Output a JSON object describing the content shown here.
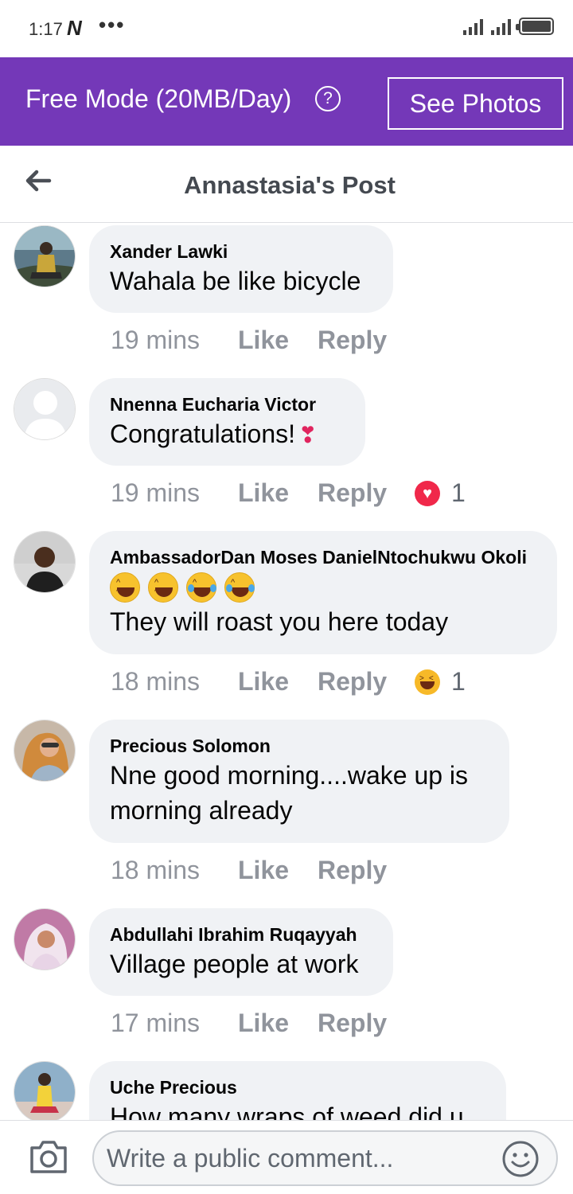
{
  "status_bar": {
    "time": "1:17",
    "carrier_glyph": "N",
    "more": "•••"
  },
  "banner": {
    "mode_text": "Free Mode (20MB/Day)",
    "help_symbol": "?",
    "see_photos_label": "See Photos",
    "color": "#7438b8"
  },
  "header": {
    "title": "Annastasia's Post"
  },
  "comments": [
    {
      "author": "Xander Lawki",
      "lines": [
        "Wahala be like bicycle"
      ],
      "time": "19 mins",
      "like": "Like",
      "reply": "Reply"
    },
    {
      "author": "Nnenna Eucharia Victor",
      "lines": [
        "Congratulations!"
      ],
      "time": "19 mins",
      "like": "Like",
      "reply": "Reply",
      "reaction": {
        "type": "love",
        "count": "1"
      }
    },
    {
      "author": "AmbassadorDan Moses DanielNtochukwu Okoli",
      "emoji_line": [
        "rofl-emoji",
        "rofl-emoji",
        "joy-emoji",
        "joy-emoji"
      ],
      "lines": [
        "They will roast you here today"
      ],
      "time": "18 mins",
      "like": "Like",
      "reply": "Reply",
      "reaction": {
        "type": "haha",
        "count": "1"
      }
    },
    {
      "author": "Precious Solomon",
      "lines": [
        "Nne good morning....wake up is",
        "morning already"
      ],
      "time": "18 mins",
      "like": "Like",
      "reply": "Reply"
    },
    {
      "author": "Abdullahi Ibrahim Ruqayyah",
      "lines": [
        "Village people at work"
      ],
      "time": "17 mins",
      "like": "Like",
      "reply": "Reply"
    },
    {
      "author": "Uche Precious",
      "lines": [
        "How many wraps of weed did u"
      ]
    }
  ],
  "composer": {
    "placeholder": "Write a public comment..."
  }
}
